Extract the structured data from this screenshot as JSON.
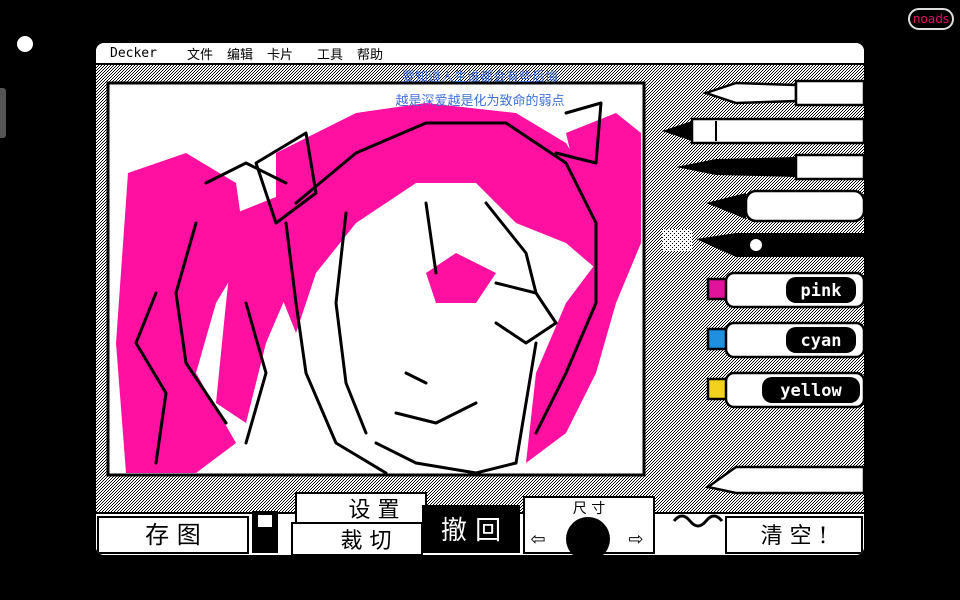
{
  "app": {
    "name": "Decker"
  },
  "menu": [
    "文件",
    "编辑",
    "卡片",
    "工具",
    "帮助"
  ],
  "overlay": {
    "nodes_badge": "noads"
  },
  "subtitle": {
    "line1": "要知道人生谁都会有些后悔",
    "line2": "越是深爱越是化为致命的弱点"
  },
  "markers": [
    {
      "label": "pink",
      "color": "#e0149a"
    },
    {
      "label": "cyan",
      "color": "#1f8fe0"
    },
    {
      "label": "yellow",
      "color": "#f2d21e"
    }
  ],
  "buttons": {
    "save": "存 图",
    "settings": "设 置",
    "crop": "裁 切",
    "undo": "撤 回",
    "size": "尺 寸",
    "clear": "清 空 !"
  },
  "colors": {
    "accent": "#ff10a0",
    "ink": "#000000",
    "paper": "#ffffff"
  }
}
